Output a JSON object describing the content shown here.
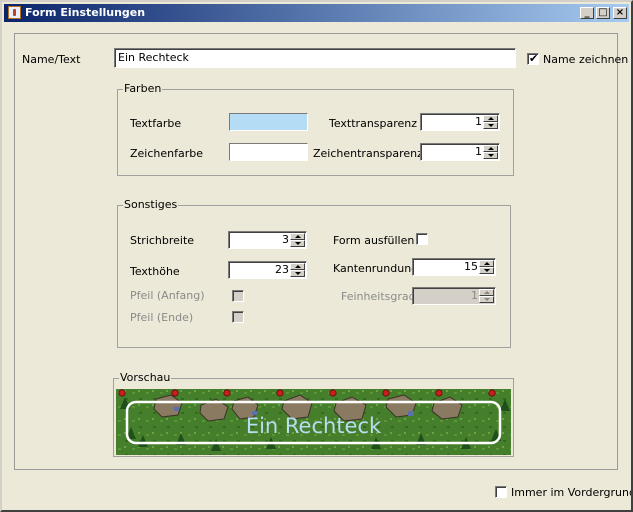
{
  "window": {
    "title": "Form Einstellungen",
    "minimize_glyph": "_",
    "maximize_glyph": "□",
    "close_glyph": "×"
  },
  "name_row": {
    "label": "Name/Text",
    "value": "Ein Rechteck",
    "draw_name_label": "Name zeichnen",
    "draw_name_checked": true
  },
  "colors_group": {
    "title": "Farben",
    "text_color_label": "Textfarbe",
    "text_color_value": "#b4dcf5",
    "draw_color_label": "Zeichenfarbe",
    "draw_color_value": "#ffffff",
    "text_transparency_label": "Texttransparenz",
    "text_transparency_value": "1",
    "draw_transparency_label": "Zeichentransparenz",
    "draw_transparency_value": "1"
  },
  "misc_group": {
    "title": "Sonstiges",
    "stroke_width_label": "Strichbreite",
    "stroke_width_value": "3",
    "text_height_label": "Texthöhe",
    "text_height_value": "23",
    "arrow_start_label": "Pfeil (Anfang)",
    "arrow_end_label": "Pfeil (Ende)",
    "fill_shape_label": "Form ausfüllen",
    "corner_radius_label": "Kantenrundung",
    "corner_radius_value": "15",
    "fineness_label": "Feinheitsgrad",
    "fineness_value": "1"
  },
  "preview": {
    "title": "Vorschau",
    "shape_text": "Ein Rechteck",
    "text_color": "#b8dcf0"
  },
  "footer": {
    "always_on_top_label": "Immer im Vordergrund"
  }
}
